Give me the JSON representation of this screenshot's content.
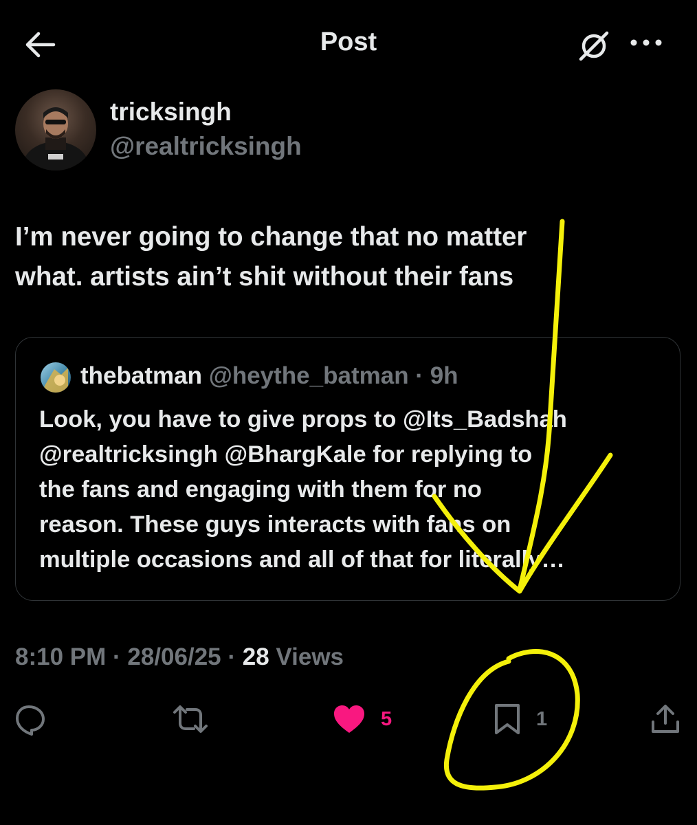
{
  "header": {
    "title": "Post",
    "back_icon": "arrow-left-icon",
    "grok_icon": "grok-icon",
    "more_icon": "more-horizontal-icon"
  },
  "author": {
    "name": "tricksingh",
    "handle": "@realtricksingh"
  },
  "post": {
    "line1": "I’m never going to change that no matter",
    "line2": "what. artists ain’t shit without their fans"
  },
  "quote": {
    "name": "thebatman",
    "handle": "@heythe_batman",
    "separator": " · ",
    "time": "9h",
    "lines": [
      "Look, you have to give props to @Its_Badshah",
      "@realtricksingh @BhargKale for replying to",
      "the fans and engaging with them for no",
      "reason. These guys interacts with fans on",
      "multiple occasions and all of that for literally…"
    ]
  },
  "meta": {
    "time": "8:10 PM",
    "sep1": " · ",
    "date": "28/06/25",
    "sep2": " · ",
    "views_count": "28",
    "views_label": " Views"
  },
  "actions": {
    "likes": "5",
    "bookmarks": "1"
  },
  "colors": {
    "background": "#000000",
    "text": "#e7e9ea",
    "secondary": "#71767b",
    "like": "#f91880",
    "annotation": "#f4f00a",
    "border": "#2f3336"
  }
}
